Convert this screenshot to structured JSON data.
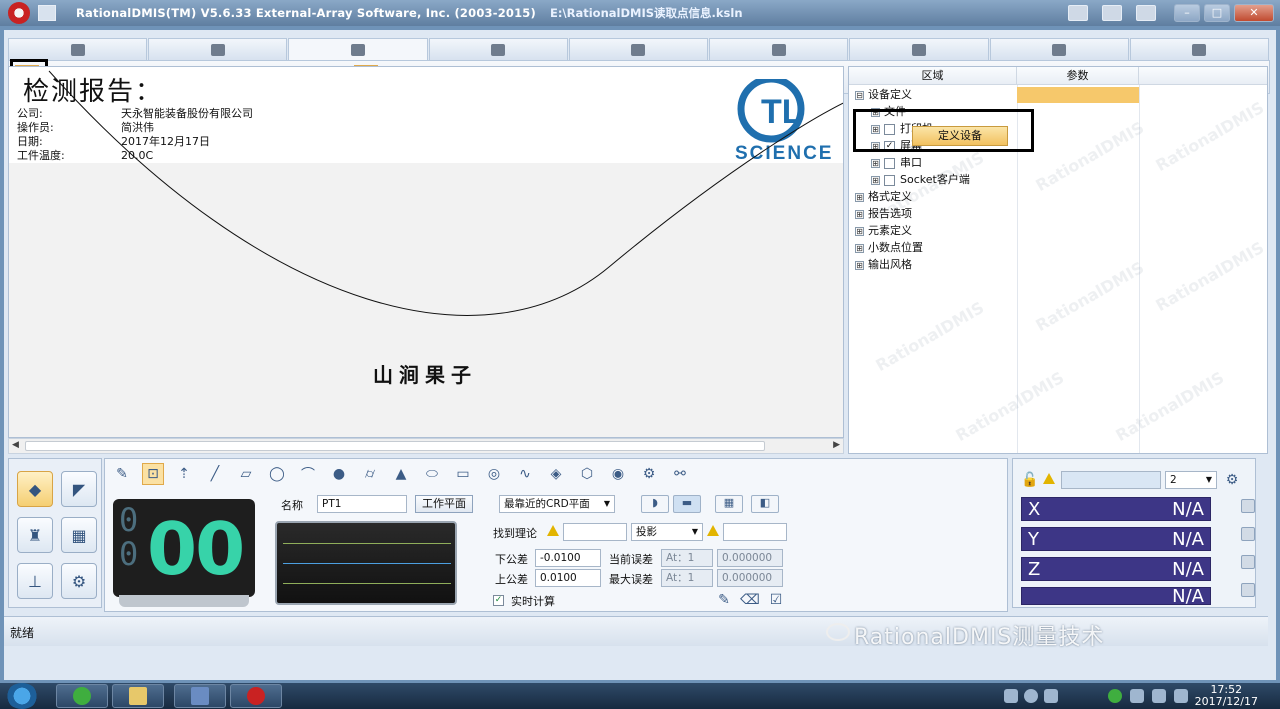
{
  "window": {
    "title": "RationalDMIS(TM) V5.6.33    External-Array Software, Inc. (2003-2015)",
    "path": "E:\\RationalDMIS读取点信息.ksln"
  },
  "ribbon": {
    "tab_icons": [
      "probe-icon",
      "report-page-icon",
      "report-grid-icon",
      "program-icon",
      "feature-icon",
      "sensor-icon",
      "cloud-icon",
      "view-icon",
      "window-icon"
    ]
  },
  "report": {
    "title": "检测报告：",
    "fields": [
      {
        "label": "公司:",
        "value": "天永智能装备股份有限公司"
      },
      {
        "label": "操作员:",
        "value": "简洪伟"
      },
      {
        "label": "日期:",
        "value": "2017年12月17日"
      },
      {
        "label": "工件温度:",
        "value": "20.0C"
      }
    ],
    "logo_text": "SCIENCE",
    "logo_mark": "TL",
    "signature": "山涧果子"
  },
  "tree": {
    "columns": [
      "区域",
      "参数"
    ],
    "nodes": [
      {
        "label": "设备定义",
        "expander": "⊟"
      },
      {
        "label": "文件",
        "expander": "⊞"
      },
      {
        "label": "打印机",
        "expander": "⊞",
        "checked": false
      },
      {
        "label": "屏幕",
        "expander": "⊞",
        "checked": true
      },
      {
        "label": "串口",
        "expander": "⊞",
        "checked": false
      },
      {
        "label": "Socket客户端",
        "expander": "⊞",
        "checked": false
      },
      {
        "label": "格式定义",
        "expander": "⊞"
      },
      {
        "label": "报告选项",
        "expander": "⊞"
      },
      {
        "label": "元素定义",
        "expander": "⊞"
      },
      {
        "label": "小数点位置",
        "expander": "⊞"
      },
      {
        "label": "输出风格",
        "expander": "⊞"
      }
    ],
    "popup": "定义设备",
    "watermark": "RationalDMIS"
  },
  "feature": {
    "counter_small_top": "0",
    "counter_small_bottom": "0",
    "counter_big": "00",
    "name_label": "名称",
    "name_value": "PT1",
    "workplane_button": "工作平面",
    "plane_select": "最靠近的CRD平面",
    "find_theory": "找到理论",
    "projection": "投影",
    "lower_tol_label": "下公差",
    "lower_tol": "-0.0100",
    "upper_tol_label": "上公差",
    "upper_tol": "0.0100",
    "current_err_label": "当前误差",
    "max_err_label": "最大误差",
    "at_value_1": "At：1",
    "at_value_2": "At：1",
    "err_value_1": "0.000000",
    "err_value_2": "0.000000",
    "realtime_label": "实时计算"
  },
  "dro": {
    "spin_value": "2",
    "axes": [
      {
        "axis": "X",
        "value": "N/A"
      },
      {
        "axis": "Y",
        "value": "N/A"
      },
      {
        "axis": "Z",
        "value": "N/A"
      },
      {
        "axis": "",
        "value": "N/A"
      }
    ]
  },
  "status": {
    "text": "就绪",
    "brand_watermark": "RationalDMIS测量技术"
  },
  "taskbar": {
    "time": "17:52",
    "date": "2017/12/17"
  },
  "colors": {
    "accent": "#f6c86b",
    "dro_bg": "#3d3686",
    "counter_green": "#37d3a9"
  }
}
